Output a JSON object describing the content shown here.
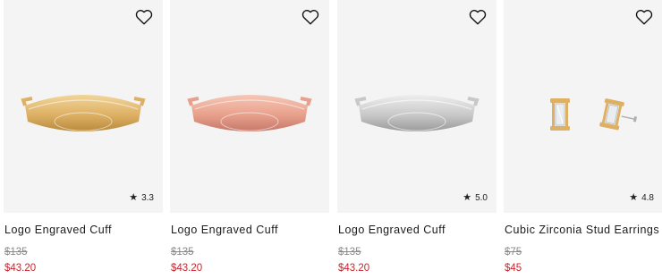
{
  "products": [
    {
      "name": "Logo Engraved Cuff",
      "original_price": "$135",
      "sale_price": "$43.20",
      "rating": "3.3",
      "finish": "gold",
      "colors": {
        "light": "#f2d59a",
        "mid": "#ddb064",
        "dark": "#b98a3d"
      }
    },
    {
      "name": "Logo Engraved Cuff",
      "original_price": "$135",
      "sale_price": "$43.20",
      "rating": "",
      "finish": "rose-gold",
      "colors": {
        "light": "#f6c7b6",
        "mid": "#e8a08c",
        "dark": "#c6786a"
      }
    },
    {
      "name": "Logo Engraved Cuff",
      "original_price": "$135",
      "sale_price": "$43.20",
      "rating": "5.0",
      "finish": "silver",
      "colors": {
        "light": "#eeeeee",
        "mid": "#c8c8c8",
        "dark": "#9a9a9a"
      }
    },
    {
      "name": "Cubic Zirconia Stud Earrings",
      "original_price": "$75",
      "sale_price": "$45",
      "rating": "4.8",
      "finish": "gold-silver",
      "colors": {
        "light": "#f2d59a",
        "mid": "#ddb064",
        "dark": "#b98a3d"
      }
    }
  ],
  "icons": {
    "wishlist": "heart-outline-icon",
    "rating": "star-icon"
  },
  "theme": {
    "sale_color": "#c8232c",
    "strike_color": "#8a8a8a",
    "tile_bg": "#f4f4f4"
  }
}
